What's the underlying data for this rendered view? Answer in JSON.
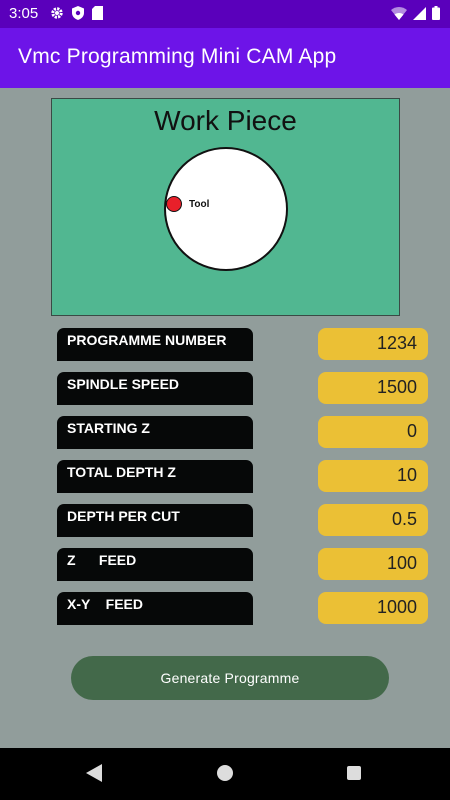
{
  "status_bar": {
    "time": "3:05",
    "icons_left": [
      "gear-icon",
      "shield-icon",
      "sd-card-icon"
    ],
    "icons_right": [
      "wifi-icon",
      "signal-icon",
      "battery-icon"
    ]
  },
  "app_bar": {
    "title": "Vmc Programming Mini CAM App"
  },
  "workpiece": {
    "title": "Work Piece",
    "tool_label": "Tool"
  },
  "params": [
    {
      "label": "PROGRAMME NUMBER",
      "value": "1234"
    },
    {
      "label": "SPINDLE SPEED",
      "value": "1500"
    },
    {
      "label": "STARTING Z",
      "value": "0"
    },
    {
      "label": "TOTAL DEPTH Z",
      "value": "10"
    },
    {
      "label": "DEPTH PER CUT",
      "value": "0.5"
    },
    {
      "label": "Z      FEED",
      "value": "100"
    },
    {
      "label": "X-Y    FEED",
      "value": "1000"
    }
  ],
  "generate_button": {
    "label": "Generate Programme"
  },
  "colors": {
    "status_bar": "#5a00bb",
    "app_bar": "#6d14e8",
    "background": "#919d9b",
    "workpiece": "#51b791",
    "label_bg": "#060808",
    "value_bg": "#ebc035",
    "button_bg": "#43694a",
    "tool": "#e8202a"
  }
}
